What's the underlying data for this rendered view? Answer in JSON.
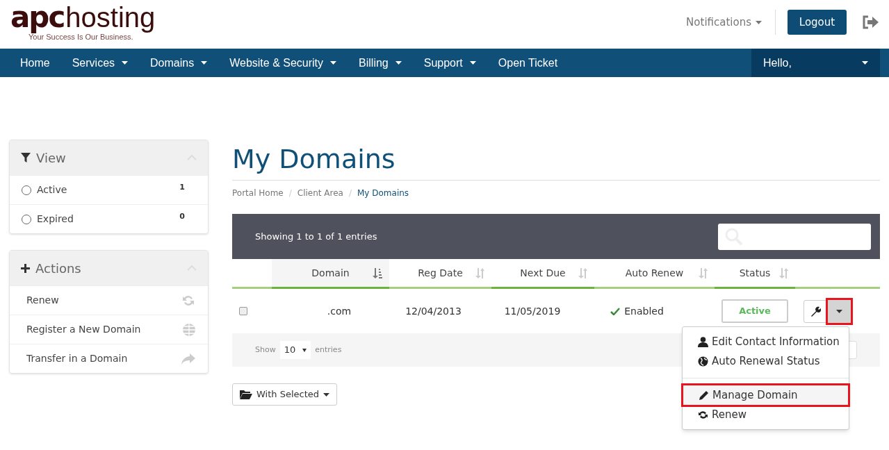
{
  "header": {
    "brand_mark": "apc",
    "brand_name": "hosting",
    "tagline": "Your Success Is Our Business.",
    "notifications": "Notifications",
    "logout": "Logout"
  },
  "nav": {
    "items": [
      {
        "label": "Home",
        "has_caret": false
      },
      {
        "label": "Services",
        "has_caret": true
      },
      {
        "label": "Domains",
        "has_caret": true
      },
      {
        "label": "Website & Security",
        "has_caret": true
      },
      {
        "label": "Billing",
        "has_caret": true
      },
      {
        "label": "Support",
        "has_caret": true
      },
      {
        "label": "Open Ticket",
        "has_caret": false
      }
    ],
    "user_menu": "Hello,"
  },
  "sidebar": {
    "view": {
      "title": "View",
      "items": [
        {
          "label": "Active",
          "count": "1",
          "checked": false
        },
        {
          "label": "Expired",
          "count": "0",
          "checked": false
        }
      ]
    },
    "actions": {
      "title": "Actions",
      "items": [
        {
          "label": "Renew"
        },
        {
          "label": "Register a New Domain"
        },
        {
          "label": "Transfer in a Domain"
        }
      ]
    }
  },
  "page_title": "My Domains",
  "breadcrumb": [
    {
      "label": "Portal Home",
      "selected": false
    },
    {
      "separator": "/",
      "label": "Client Area",
      "selected": false
    },
    {
      "separator": "/",
      "label": "My Domains",
      "selected": true
    }
  ],
  "table": {
    "info": "Showing 1 to 1 of 1 entries",
    "columns": [
      {
        "label": "Domain",
        "sorted": true
      },
      {
        "label": "Reg Date",
        "sorted": false
      },
      {
        "label": "Next Due",
        "sorted": false
      },
      {
        "label": "Auto Renew",
        "sorted": false
      },
      {
        "label": "Status",
        "sorted": false
      }
    ],
    "rows": [
      {
        "checked": false,
        "domain": ".com",
        "reg_date": "12/04/2013",
        "next_due": "11/05/2019",
        "auto_renew": "Enabled",
        "status": "Active",
        "caret_highlighted": true
      }
    ],
    "footer": {
      "show": "Show",
      "page_size": "10",
      "entries": "entries"
    }
  },
  "with_selected": "With Selected",
  "row_menu": {
    "items": [
      {
        "label": "Edit Contact Information",
        "divider_before": false,
        "highlighted": false
      },
      {
        "label": "Auto Renewal Status",
        "divider_before": false,
        "highlighted": false
      },
      {
        "label": "Manage Domain",
        "divider_before": true,
        "highlighted": true
      },
      {
        "label": "Renew",
        "divider_before": false,
        "highlighted": false
      }
    ]
  }
}
